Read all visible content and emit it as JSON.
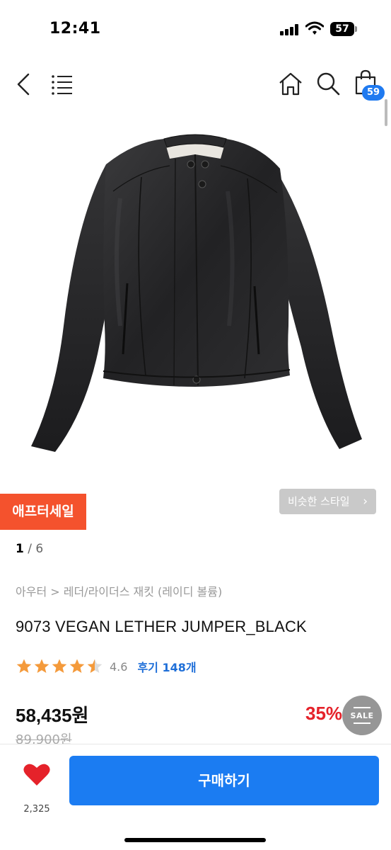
{
  "status_bar": {
    "time": "12:41",
    "battery": "57"
  },
  "nav": {
    "cart_count": "59"
  },
  "product": {
    "image_alt": "black vegan leather rider jacket",
    "sale_tag": "애프터세일",
    "similar_style": "비슷한 스타일",
    "pager": {
      "current": "1",
      "separator": " / ",
      "total": "6"
    },
    "breadcrumb": "아우터 > 레더/라이더스 재킷 (레이디 볼륨)",
    "title": "9073 VEGAN LETHER JUMPER_BLACK",
    "rating": {
      "value": "4.6",
      "review_label": "후기 148개",
      "stars": 4.5
    },
    "price": {
      "current": "58,435원",
      "original": "89,900원",
      "discount": "35%"
    },
    "sale_fab_label": "SALE"
  },
  "bottom_bar": {
    "like_count": "2,325",
    "buy_label": "구매하기"
  },
  "colors": {
    "accent": "#1b7cf2",
    "sale_tag": "#f4522d",
    "discount": "#e5222a",
    "star": "#f49a3b",
    "heart": "#e5222a"
  }
}
